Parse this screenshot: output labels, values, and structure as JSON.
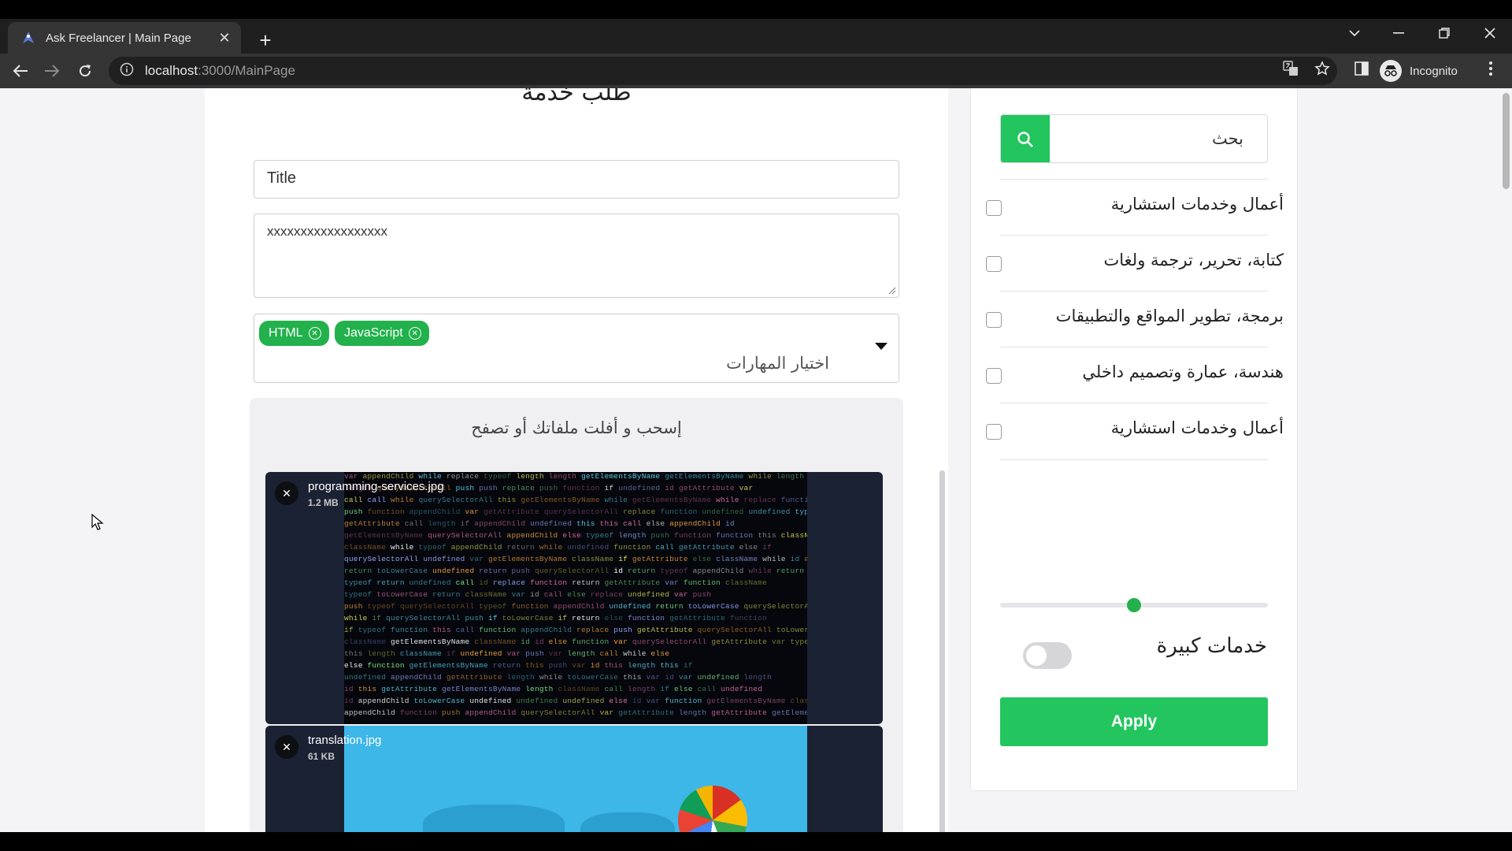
{
  "browser": {
    "tab_title": "Ask Freelancer | Main Page",
    "url_host": "localhost",
    "url_path": ":3000/MainPage",
    "profile_label": "Incognito"
  },
  "form": {
    "heading": "طلب خدمة",
    "title_placeholder": "Title",
    "description_value": "xxxxxxxxxxxxxxxxxx",
    "skills": [
      {
        "label": "HTML"
      },
      {
        "label": "JavaScript"
      }
    ],
    "skills_placeholder": "اختيار المهارات",
    "dropzone_label": "إسحب و أفلت ملفاتك أو تصفح",
    "files": [
      {
        "name": "programming-services.jpg",
        "size": "1.2 MB"
      },
      {
        "name": "translation.jpg",
        "size": "61 KB"
      }
    ]
  },
  "sidebar": {
    "search_placeholder": "بحث",
    "categories": [
      {
        "label": "أعمال وخدمات استشارية",
        "checked": false
      },
      {
        "label": "كتابة، تحرير، ترجمة ولغات",
        "checked": false
      },
      {
        "label": "برمجة، تطوير المواقع والتطبيقات",
        "checked": false
      },
      {
        "label": "هندسة، عمارة وتصميم داخلي",
        "checked": false
      },
      {
        "label": "أعمال وخدمات استشارية",
        "checked": false
      }
    ],
    "slider_value": 0.5,
    "toggle_label": "خدمات كبيرة",
    "toggle_on": false,
    "apply_label": "Apply"
  },
  "colors": {
    "accent": "#22c55e",
    "chip": "#22b14c"
  }
}
